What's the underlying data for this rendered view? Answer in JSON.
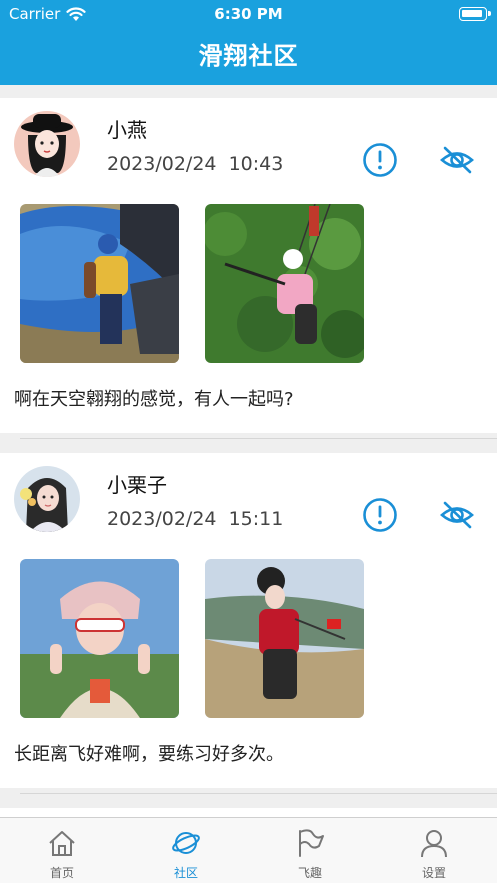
{
  "status_bar": {
    "carrier": "Carrier",
    "time": "6:30 PM"
  },
  "header": {
    "title": "滑翔社区"
  },
  "colors": {
    "accent": "#1aa1de",
    "icon_blue": "#1a8fd6",
    "tab_inactive": "#777777"
  },
  "posts": [
    {
      "username": "小燕",
      "timestamp": "2023/02/24  10:43",
      "caption": "啊在天空翱翔的感觉，有人一起吗?",
      "photos": [
        "paraglider-with-blue-wing",
        "paraglider-flying-over-forest"
      ]
    },
    {
      "username": "小栗子",
      "timestamp": "2023/02/24  15:11",
      "caption": "长距离飞好难啊，要练习好多次。",
      "photos": [
        "woman-with-sunglasses-and-cat-ear-hat",
        "paraglider-on-hillside"
      ]
    }
  ],
  "post_icons": {
    "report": "exclamation-circle-icon",
    "hide": "eye-slash-icon"
  },
  "tabbar": {
    "items": [
      {
        "label": "首页",
        "icon": "home-icon"
      },
      {
        "label": "社区",
        "icon": "planet-icon",
        "active": true
      },
      {
        "label": "飞趣",
        "icon": "flag-icon"
      },
      {
        "label": "设置",
        "icon": "person-icon"
      }
    ]
  }
}
